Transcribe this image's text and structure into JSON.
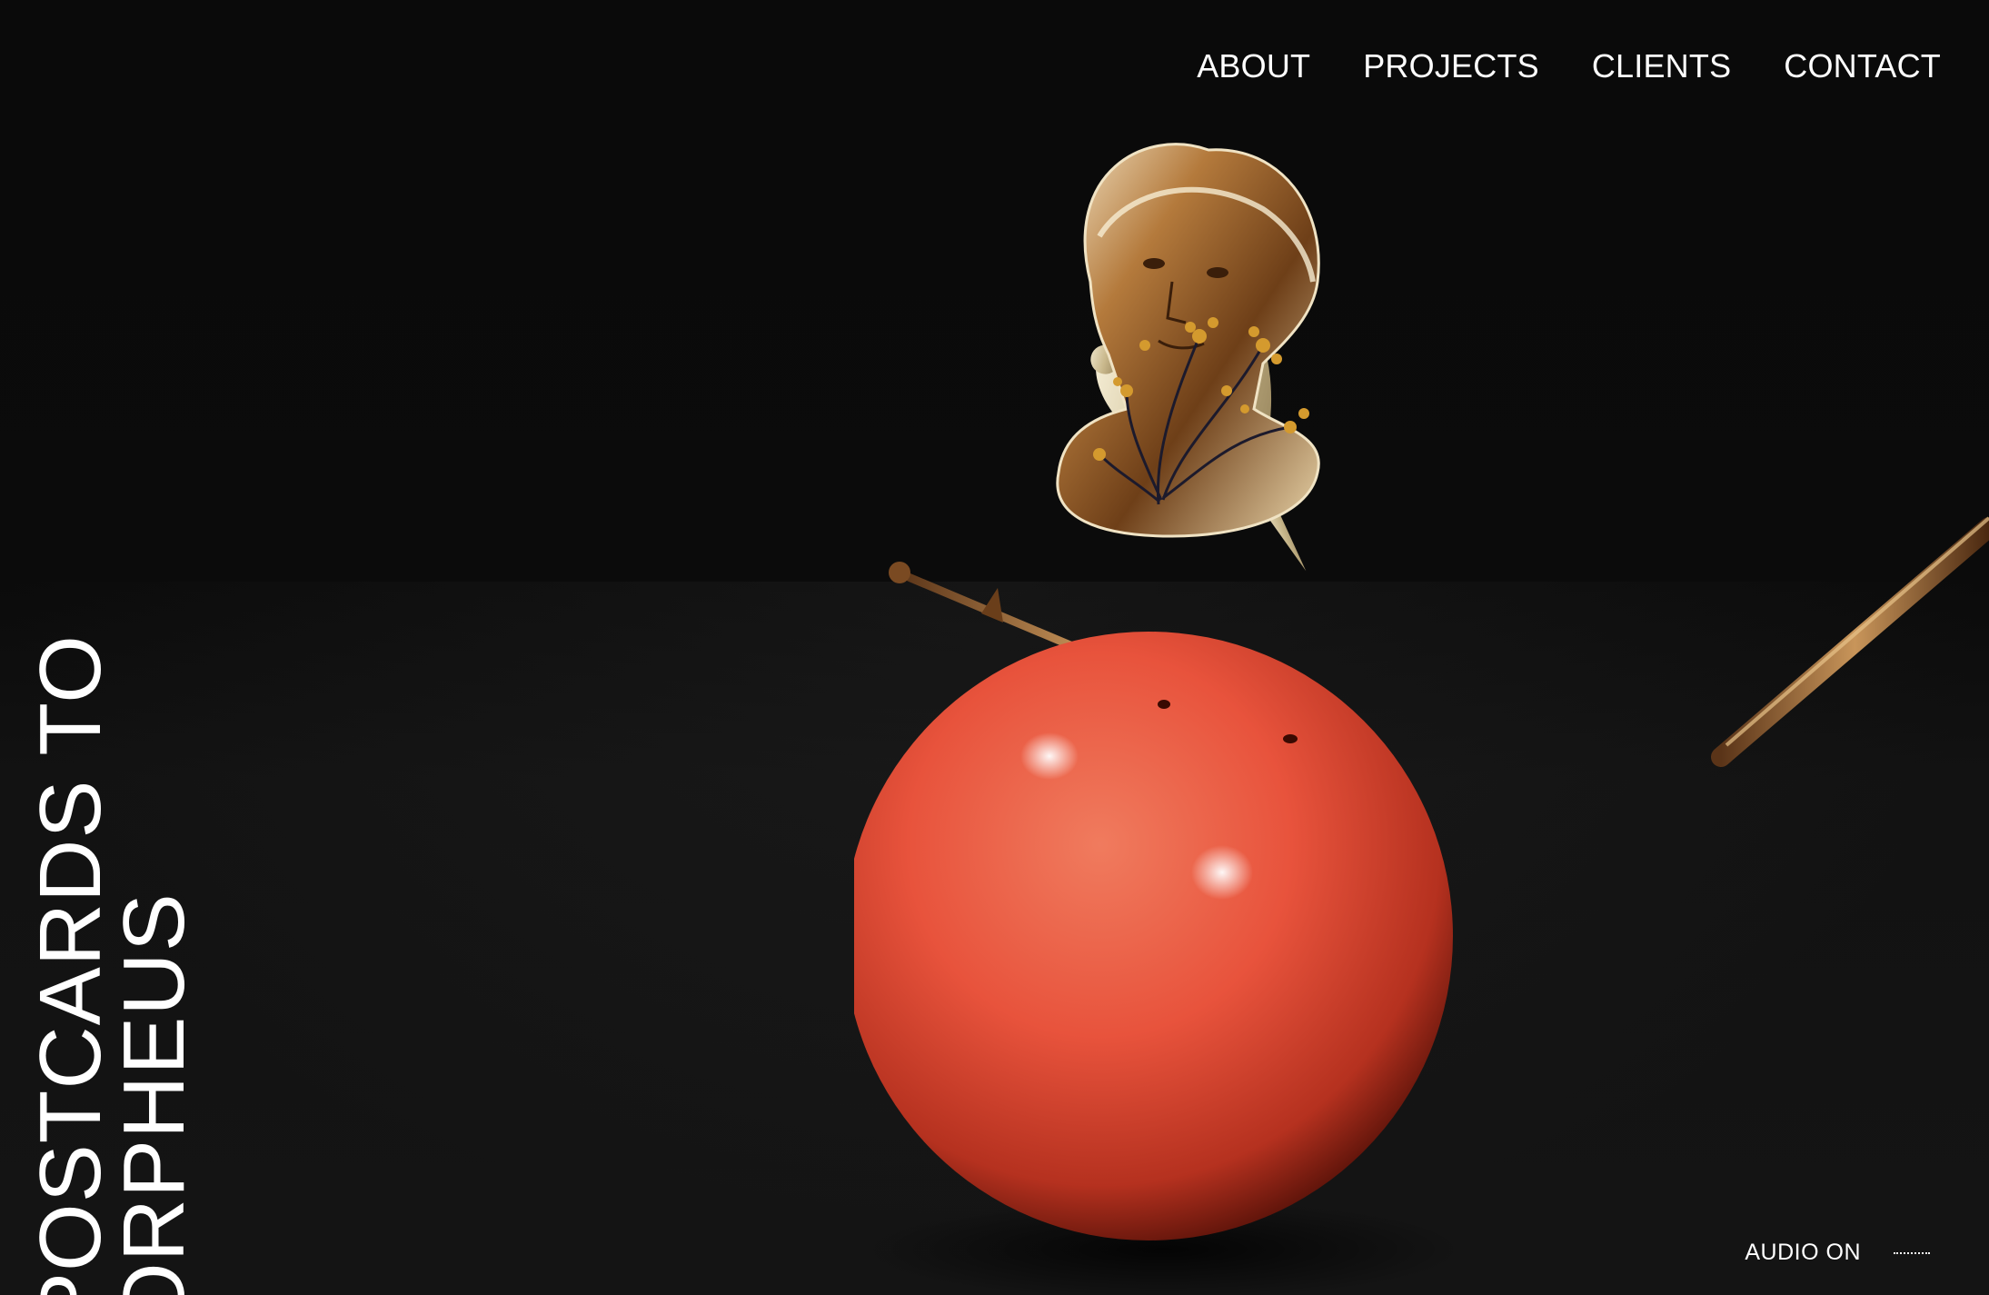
{
  "nav": {
    "items": [
      {
        "label": "ABOUT"
      },
      {
        "label": "PROJECTS"
      },
      {
        "label": "CLIENTS"
      },
      {
        "label": "CONTACT"
      }
    ]
  },
  "hero": {
    "title_line1": "POSTCARDS TO",
    "title_line2": "ORPHEUS"
  },
  "audio": {
    "label": "AUDIO ON",
    "icon": "audio-wave-icon"
  },
  "colors": {
    "background": "#0b0b0b",
    "sphere": "#e8533c",
    "bronze": "#a8743a",
    "gold": "#d8c9a0",
    "text": "#ffffff"
  }
}
